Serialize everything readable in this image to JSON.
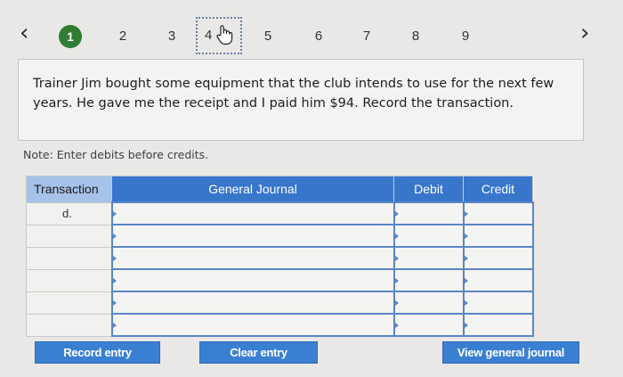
{
  "nav": {
    "prev_icon": "chevron-left-icon",
    "next_icon": "chevron-right-icon",
    "prev_glyph": "‹",
    "next_glyph": "›",
    "steps": [
      {
        "label": "1",
        "state": "completed"
      },
      {
        "label": "2",
        "state": "pending"
      },
      {
        "label": "3",
        "state": "pending"
      },
      {
        "label": "4",
        "state": "current"
      },
      {
        "label": "5",
        "state": "pending"
      },
      {
        "label": "6",
        "state": "pending"
      },
      {
        "label": "7",
        "state": "pending"
      },
      {
        "label": "8",
        "state": "pending"
      },
      {
        "label": "9",
        "state": "pending"
      }
    ],
    "cursor_icon": "hand-pointer-icon"
  },
  "question": {
    "text": "Trainer Jim bought some equipment that the club intends to use for the next few years. He gave me the receipt and I paid him $94. Record the transaction."
  },
  "note": "Note: Enter debits before credits.",
  "journal": {
    "headers": [
      "Transaction",
      "General Journal",
      "Debit",
      "Credit"
    ],
    "rows": [
      {
        "transaction": "d.",
        "account": "",
        "debit": "",
        "credit": ""
      },
      {
        "transaction": "",
        "account": "",
        "debit": "",
        "credit": ""
      },
      {
        "transaction": "",
        "account": "",
        "debit": "",
        "credit": ""
      },
      {
        "transaction": "",
        "account": "",
        "debit": "",
        "credit": ""
      },
      {
        "transaction": "",
        "account": "",
        "debit": "",
        "credit": ""
      },
      {
        "transaction": "",
        "account": "",
        "debit": "",
        "credit": ""
      }
    ]
  },
  "buttons": {
    "record": "Record entry",
    "clear": "Clear entry",
    "view": "View general journal"
  },
  "colors": {
    "step_completed": "#2e7d32",
    "header_blue": "#3876cc",
    "header_first_col": "#a6c2e8",
    "button_blue": "#3a80d2",
    "input_border": "#5b86c4"
  }
}
